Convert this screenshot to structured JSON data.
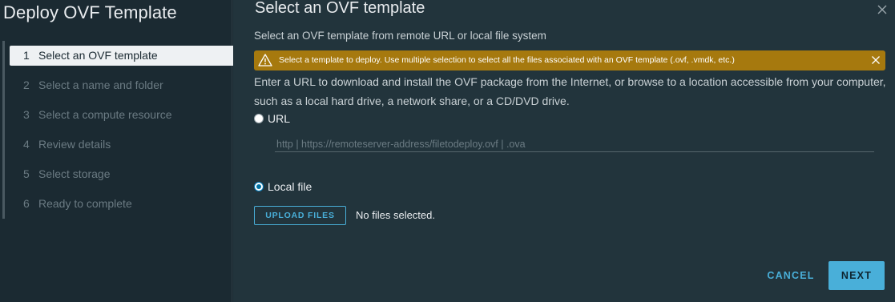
{
  "wizard": {
    "title": "Deploy OVF Template"
  },
  "steps": [
    {
      "num": "1",
      "label": "Select an OVF template",
      "state": "active"
    },
    {
      "num": "2",
      "label": "Select a name and folder",
      "state": "disabled"
    },
    {
      "num": "3",
      "label": "Select a compute resource",
      "state": "disabled"
    },
    {
      "num": "4",
      "label": "Review details",
      "state": "disabled"
    },
    {
      "num": "5",
      "label": "Select storage",
      "state": "disabled"
    },
    {
      "num": "6",
      "label": "Ready to complete",
      "state": "disabled"
    }
  ],
  "page": {
    "title": "Select an OVF template",
    "subtitle": "Select an OVF template from remote URL or local file system",
    "close_icon": "close-icon"
  },
  "alert": {
    "icon": "warning-icon",
    "text": "Select a template to deploy. Use multiple selection to select all the files associated with an OVF template (.ovf, .vmdk, etc.)",
    "color": "#a6790e"
  },
  "description": "Enter a URL to download and install the OVF package from the Internet, or browse to a location accessible from your computer, such as a local hard drive, a network share, or a CD/DVD drive.",
  "source": {
    "url_option": {
      "label": "URL",
      "selected": false
    },
    "url_input": {
      "value": "",
      "placeholder": "http | https://remoteserver-address/filetodeploy.ovf | .ova"
    },
    "local_option": {
      "label": "Local file",
      "selected": true
    },
    "upload_button": "UPLOAD FILES",
    "file_status": "No files selected."
  },
  "footer": {
    "cancel_label": "CANCEL",
    "next_label": "NEXT"
  },
  "colors": {
    "accent": "#49afd9",
    "background_left": "#1b2a32",
    "background_right": "#22343c",
    "active_step_bg": "#eef1f3"
  }
}
